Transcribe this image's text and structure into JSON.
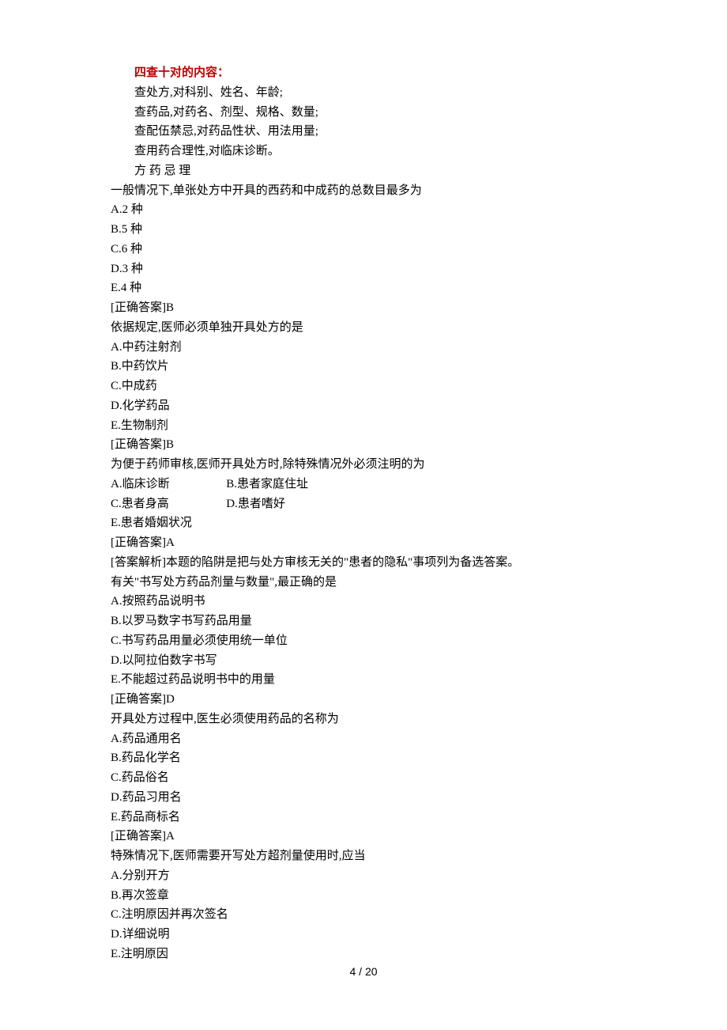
{
  "heading": {
    "title": "四查十对的内容："
  },
  "checks": [
    "查处方,对科别、姓名、年龄;",
    "查药品,对药名、剂型、规格、数量;",
    "查配伍禁忌,对药品性状、用法用量;",
    "查用药合理性,对临床诊断。"
  ],
  "mnemonic": "方 药 忌 理",
  "q1": {
    "stem": "一般情况下,单张处方中开具的西药和中成药的总数目最多为",
    "A": "A.2 种",
    "B": "B.5 种",
    "C": "C.6 种",
    "D": "D.3 种",
    "E": "E.4 种",
    "answer": "[正确答案]B"
  },
  "q2": {
    "stem": "依据规定,医师必须单独开具处方的是",
    "A": "A.中药注射剂",
    "B": "B.中药饮片",
    "C": "C.中成药",
    "D": "D.化学药品",
    "E": "E.生物制剂",
    "answer": "[正确答案]B"
  },
  "q3": {
    "stem": "为便于药师审核,医师开具处方时,除特殊情况外必须注明的为",
    "A": "A.临床诊断",
    "B": "B.患者家庭住址",
    "C": "C.患者身高",
    "D": "D.患者嗜好",
    "E": "E.患者婚姻状况",
    "answer": "[正确答案]A",
    "explain": "[答案解析]本题的陷阱是把与处方审核无关的\"患者的隐私\"事项列为备选答案。"
  },
  "q4": {
    "stem": "有关\"书写处方药品剂量与数量\",最正确的是",
    "A": "A.按照药品说明书",
    "B": "B.以罗马数字书写药品用量",
    "C": "C.书写药品用量必须使用统一单位",
    "D": "D.以阿拉伯数字书写",
    "E": "E.不能超过药品说明书中的用量",
    "answer": "[正确答案]D"
  },
  "q5": {
    "stem": "开具处方过程中,医生必须使用药品的名称为",
    "A": "A.药品通用名",
    "B": "B.药品化学名",
    "C": "C.药品俗名",
    "D": "D.药品习用名",
    "E": "E.药品商标名",
    "answer": "[正确答案]A"
  },
  "q6": {
    "stem": "特殊情况下,医师需要开写处方超剂量使用时,应当",
    "A": "A.分别开方",
    "B": "B.再次签章",
    "C": "C.注明原因并再次签名",
    "D": "D.详细说明",
    "E": "E.注明原因"
  },
  "pager": "4 / 20"
}
